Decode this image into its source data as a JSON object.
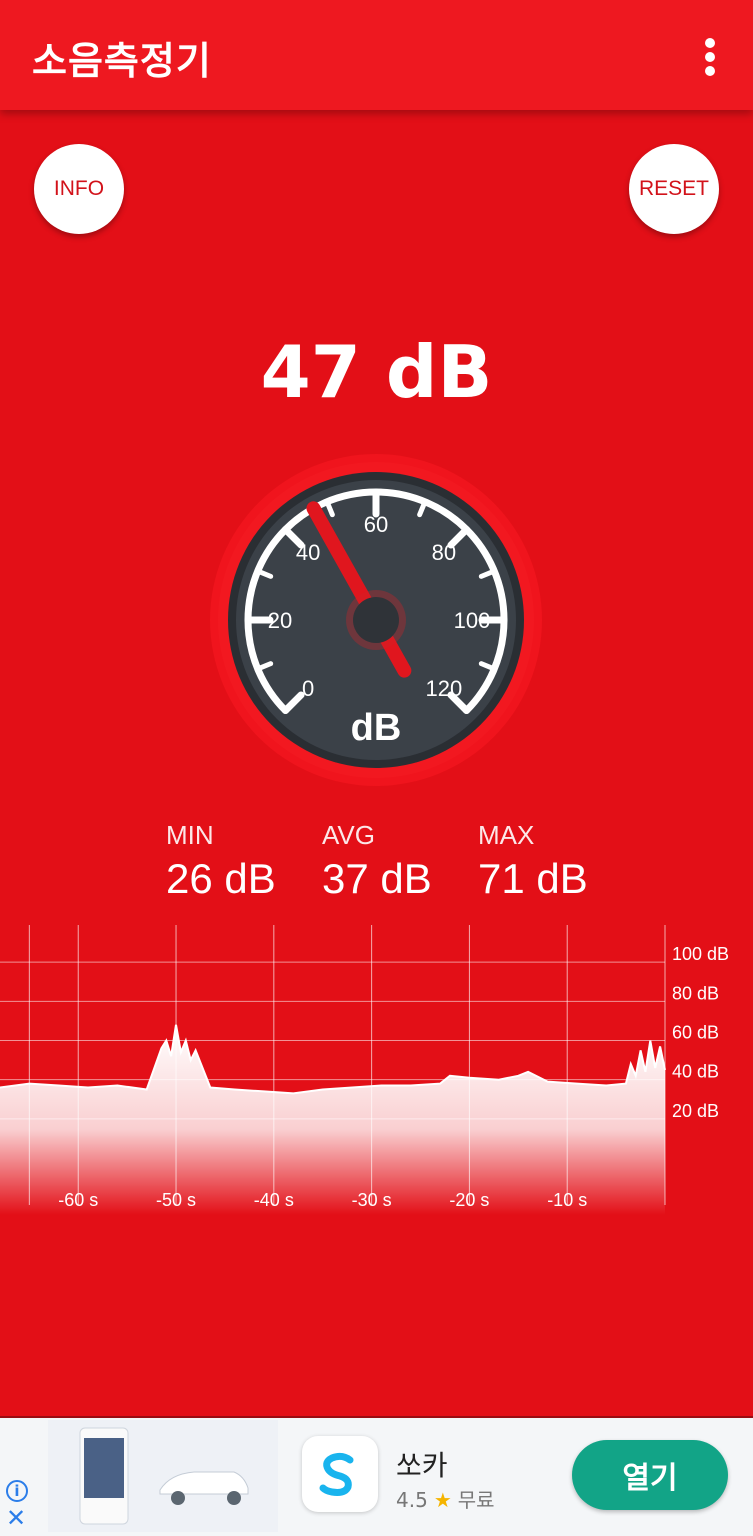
{
  "appbar": {
    "title": "소음측정기",
    "menu_icon": "more-vert-icon"
  },
  "buttons": {
    "info": "INFO",
    "reset": "RESET"
  },
  "reading": {
    "value": 47,
    "display": "47 dB"
  },
  "gauge": {
    "min": 0,
    "max": 120,
    "needle_value": 47,
    "tick_labels": [
      "0",
      "20",
      "40",
      "60",
      "80",
      "100",
      "120"
    ],
    "unit": "dB",
    "colors": {
      "face": "#3b4148",
      "bezel": "#2a2e33",
      "needle": "#e0161e",
      "ring": "#f0141d"
    }
  },
  "stats": [
    {
      "label": "MIN",
      "value": "26 dB"
    },
    {
      "label": "AVG",
      "value": "37 dB"
    },
    {
      "label": "MAX",
      "value": "71 dB"
    }
  ],
  "chart_data": {
    "type": "area",
    "x_ticks": [
      "-60 s",
      "-50 s",
      "-40 s",
      "-30 s",
      "-20 s",
      "-10 s"
    ],
    "y_ticks": [
      "20 dB",
      "40 dB",
      "60 dB",
      "80 dB",
      "100 dB"
    ],
    "xlim": [
      -68,
      0
    ],
    "ylim": [
      0,
      120
    ],
    "grid": true,
    "series": [
      {
        "x": [
          -68,
          -65,
          -62,
          -59,
          -56,
          -53,
          -51.5,
          -51,
          -50.5,
          -50,
          -49.5,
          -49,
          -48.5,
          -48,
          -46.5,
          -44,
          -41,
          -38,
          -35,
          -32,
          -29,
          -26,
          -23,
          -22,
          -20,
          -17,
          -15,
          -14,
          -12,
          -9,
          -6,
          -4,
          -3.5,
          -3,
          -2.5,
          -2,
          -1.5,
          -1,
          -0.5,
          0
        ],
        "y": [
          36,
          38,
          37,
          36,
          37,
          35,
          56,
          60,
          52,
          68,
          54,
          60,
          50,
          55,
          36,
          35,
          34,
          33,
          35,
          36,
          37,
          37,
          38,
          42,
          41,
          40,
          42,
          44,
          39,
          38,
          37,
          38,
          48,
          42,
          55,
          44,
          60,
          46,
          57,
          45
        ]
      }
    ]
  },
  "ad": {
    "app_name": "쏘카",
    "rating": "4.5",
    "price": "무료",
    "open_button": "열기",
    "info_icon": "info-icon",
    "close_icon": "close-icon"
  }
}
